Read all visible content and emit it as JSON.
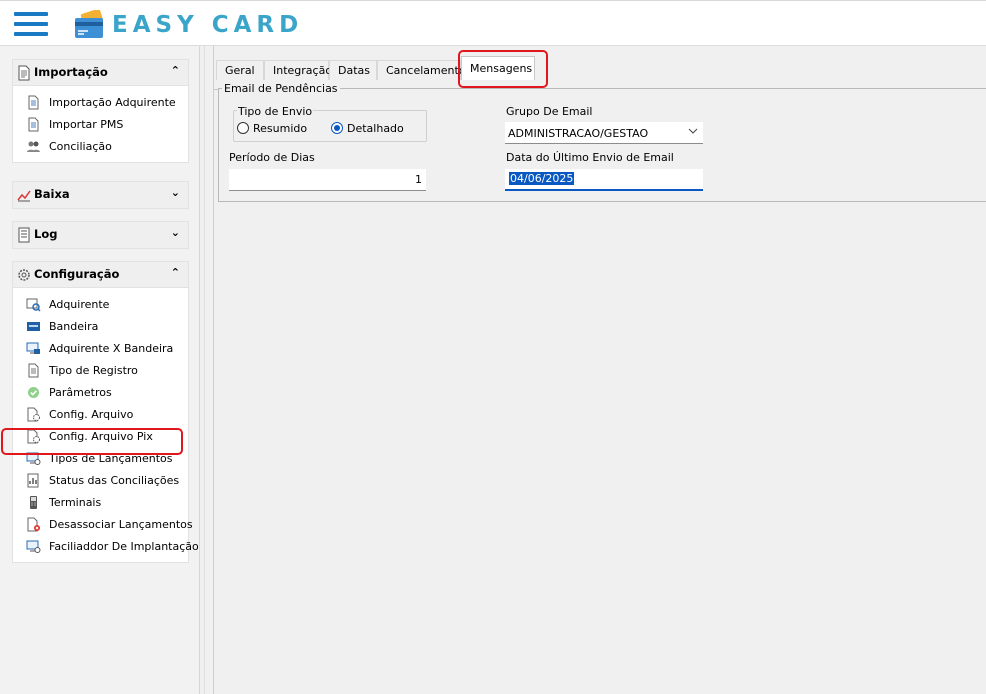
{
  "app": {
    "brand": "EASY CARD"
  },
  "sidebar": {
    "importacao": {
      "title": "Importação",
      "items": [
        {
          "label": "Importação Adquirente",
          "icon": "document-icon"
        },
        {
          "label": "Importar PMS",
          "icon": "document-icon"
        },
        {
          "label": "Conciliação",
          "icon": "people-icon"
        }
      ]
    },
    "baixa": {
      "title": "Baixa"
    },
    "log": {
      "title": "Log"
    },
    "configuracao": {
      "title": "Configuração",
      "items": [
        {
          "label": "Adquirente",
          "icon": "search-report-icon"
        },
        {
          "label": "Bandeira",
          "icon": "card-brand-icon"
        },
        {
          "label": "Adquirente X Bandeira",
          "icon": "monitor-card-icon"
        },
        {
          "label": "Tipo de Registro",
          "icon": "document-icon"
        },
        {
          "label": "Parâmetros",
          "icon": "check-circle-icon"
        },
        {
          "label": "Config. Arquivo",
          "icon": "file-gear-icon"
        },
        {
          "label": "Config. Arquivo Pix",
          "icon": "file-gear-icon"
        },
        {
          "label": "Tipos de Lançamentos",
          "icon": "monitor-gear-icon"
        },
        {
          "label": "Status das Conciliações",
          "icon": "status-chart-icon"
        },
        {
          "label": "Terminais",
          "icon": "terminal-icon"
        },
        {
          "label": "Desassociar Lançamentos",
          "icon": "file-remove-icon"
        },
        {
          "label": "Faciliaddor De Implantação",
          "icon": "monitor-gear-icon"
        }
      ]
    }
  },
  "tabs": [
    {
      "label": "Geral"
    },
    {
      "label": "Integração"
    },
    {
      "label": "Datas"
    },
    {
      "label": "Cancelamento"
    },
    {
      "label": "Mensagens",
      "active": true
    }
  ],
  "form": {
    "group_title": "Email de Pendências",
    "tipo_envio": {
      "label": "Tipo de Envio",
      "options": [
        "Resumido",
        "Detalhado"
      ],
      "selected": "Detalhado"
    },
    "periodo": {
      "label": "Período de Dias",
      "value": "1"
    },
    "grupo_email": {
      "label": "Grupo De Email",
      "value": "ADMINISTRACAO/GESTAO"
    },
    "ultimo_envio": {
      "label": "Data do Último Envio de Email",
      "value": "04/06/2025"
    }
  },
  "colors": {
    "accent": "#1a7bc4",
    "brand_text": "#3aa5c9",
    "highlight": "#e0181e",
    "selection": "#0a58c2"
  }
}
